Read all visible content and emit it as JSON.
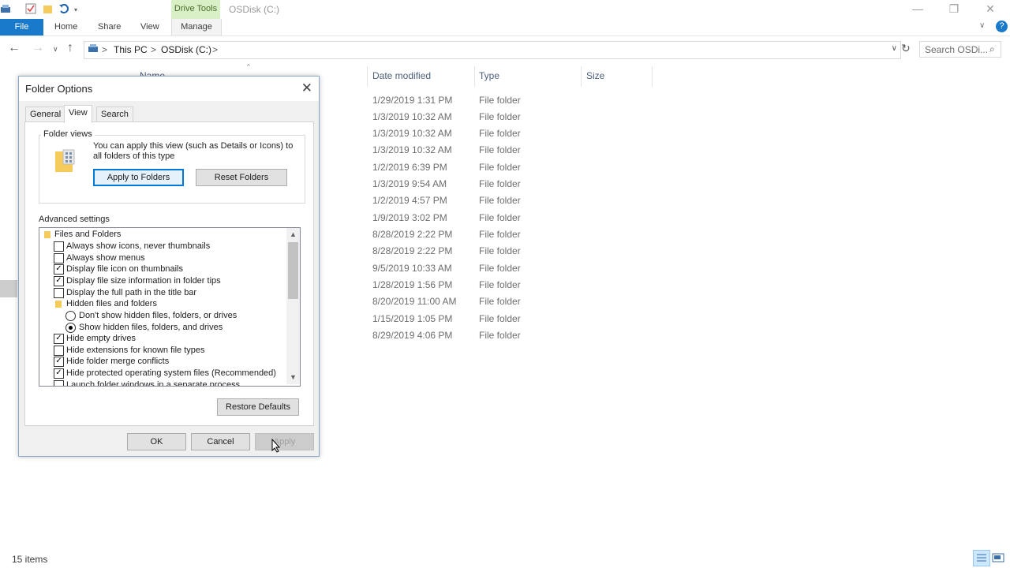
{
  "window": {
    "title": "OSDisk (C:)",
    "contextual_tab": "Drive Tools",
    "minimize": "—",
    "maximize": "❐",
    "close": "✕"
  },
  "ribbon": {
    "tabs": [
      "File",
      "Home",
      "Share",
      "View",
      "Manage"
    ],
    "help": "?"
  },
  "address": {
    "breadcrumb": [
      "This PC",
      "OSDisk (C:)"
    ],
    "separator": ">",
    "search_placeholder": "Search OSDi..."
  },
  "file_list": {
    "columns": [
      "Name",
      "Date modified",
      "Type",
      "Size"
    ],
    "rows": [
      {
        "date": "1/29/2019 1:31 PM",
        "type": "File folder"
      },
      {
        "date": "1/3/2019 10:32 AM",
        "type": "File folder"
      },
      {
        "date": "1/3/2019 10:32 AM",
        "type": "File folder"
      },
      {
        "date": "1/3/2019 10:32 AM",
        "type": "File folder"
      },
      {
        "date": "1/2/2019 6:39 PM",
        "type": "File folder"
      },
      {
        "date": "1/3/2019 9:54 AM",
        "type": "File folder"
      },
      {
        "date": "1/2/2019 4:57 PM",
        "type": "File folder"
      },
      {
        "date": "1/9/2019 3:02 PM",
        "type": "File folder"
      },
      {
        "date": "8/28/2019 2:22 PM",
        "type": "File folder"
      },
      {
        "date": "8/28/2019 2:22 PM",
        "type": "File folder"
      },
      {
        "date": "9/5/2019 10:33 AM",
        "type": "File folder"
      },
      {
        "date": "1/28/2019 1:56 PM",
        "type": "File folder"
      },
      {
        "date": "8/20/2019 11:00 AM",
        "type": "File folder"
      },
      {
        "date": "1/15/2019 1:05 PM",
        "type": "File folder"
      },
      {
        "date": "8/29/2019 4:06 PM",
        "type": "File folder"
      }
    ]
  },
  "status": {
    "items": "15 items"
  },
  "dialog": {
    "title": "Folder Options",
    "tabs": [
      "General",
      "View",
      "Search"
    ],
    "active_tab": "View",
    "folder_views": {
      "label": "Folder views",
      "text": "You can apply this view (such as Details or Icons) to all folders of this type",
      "apply_button": "Apply to Folders",
      "reset_button": "Reset Folders"
    },
    "advanced_label": "Advanced settings",
    "settings": [
      {
        "kind": "folder",
        "label": "Files and Folders"
      },
      {
        "kind": "checkbox",
        "label": "Always show icons, never thumbnails",
        "checked": false
      },
      {
        "kind": "checkbox",
        "label": "Always show menus",
        "checked": false
      },
      {
        "kind": "checkbox",
        "label": "Display file icon on thumbnails",
        "checked": true
      },
      {
        "kind": "checkbox",
        "label": "Display file size information in folder tips",
        "checked": true
      },
      {
        "kind": "checkbox",
        "label": "Display the full path in the title bar",
        "checked": false
      },
      {
        "kind": "folder",
        "label": "Hidden files and folders"
      },
      {
        "kind": "radio",
        "label": "Don't show hidden files, folders, or drives",
        "checked": false
      },
      {
        "kind": "radio",
        "label": "Show hidden files, folders, and drives",
        "checked": true
      },
      {
        "kind": "checkbox",
        "label": "Hide empty drives",
        "checked": true
      },
      {
        "kind": "checkbox",
        "label": "Hide extensions for known file types",
        "checked": false
      },
      {
        "kind": "checkbox",
        "label": "Hide folder merge conflicts",
        "checked": true
      },
      {
        "kind": "checkbox",
        "label": "Hide protected operating system files (Recommended)",
        "checked": true
      },
      {
        "kind": "checkbox",
        "label": "Launch folder windows in a separate process",
        "checked": false
      }
    ],
    "restore_defaults": "Restore Defaults",
    "ok": "OK",
    "cancel": "Cancel",
    "apply": "Apply"
  }
}
